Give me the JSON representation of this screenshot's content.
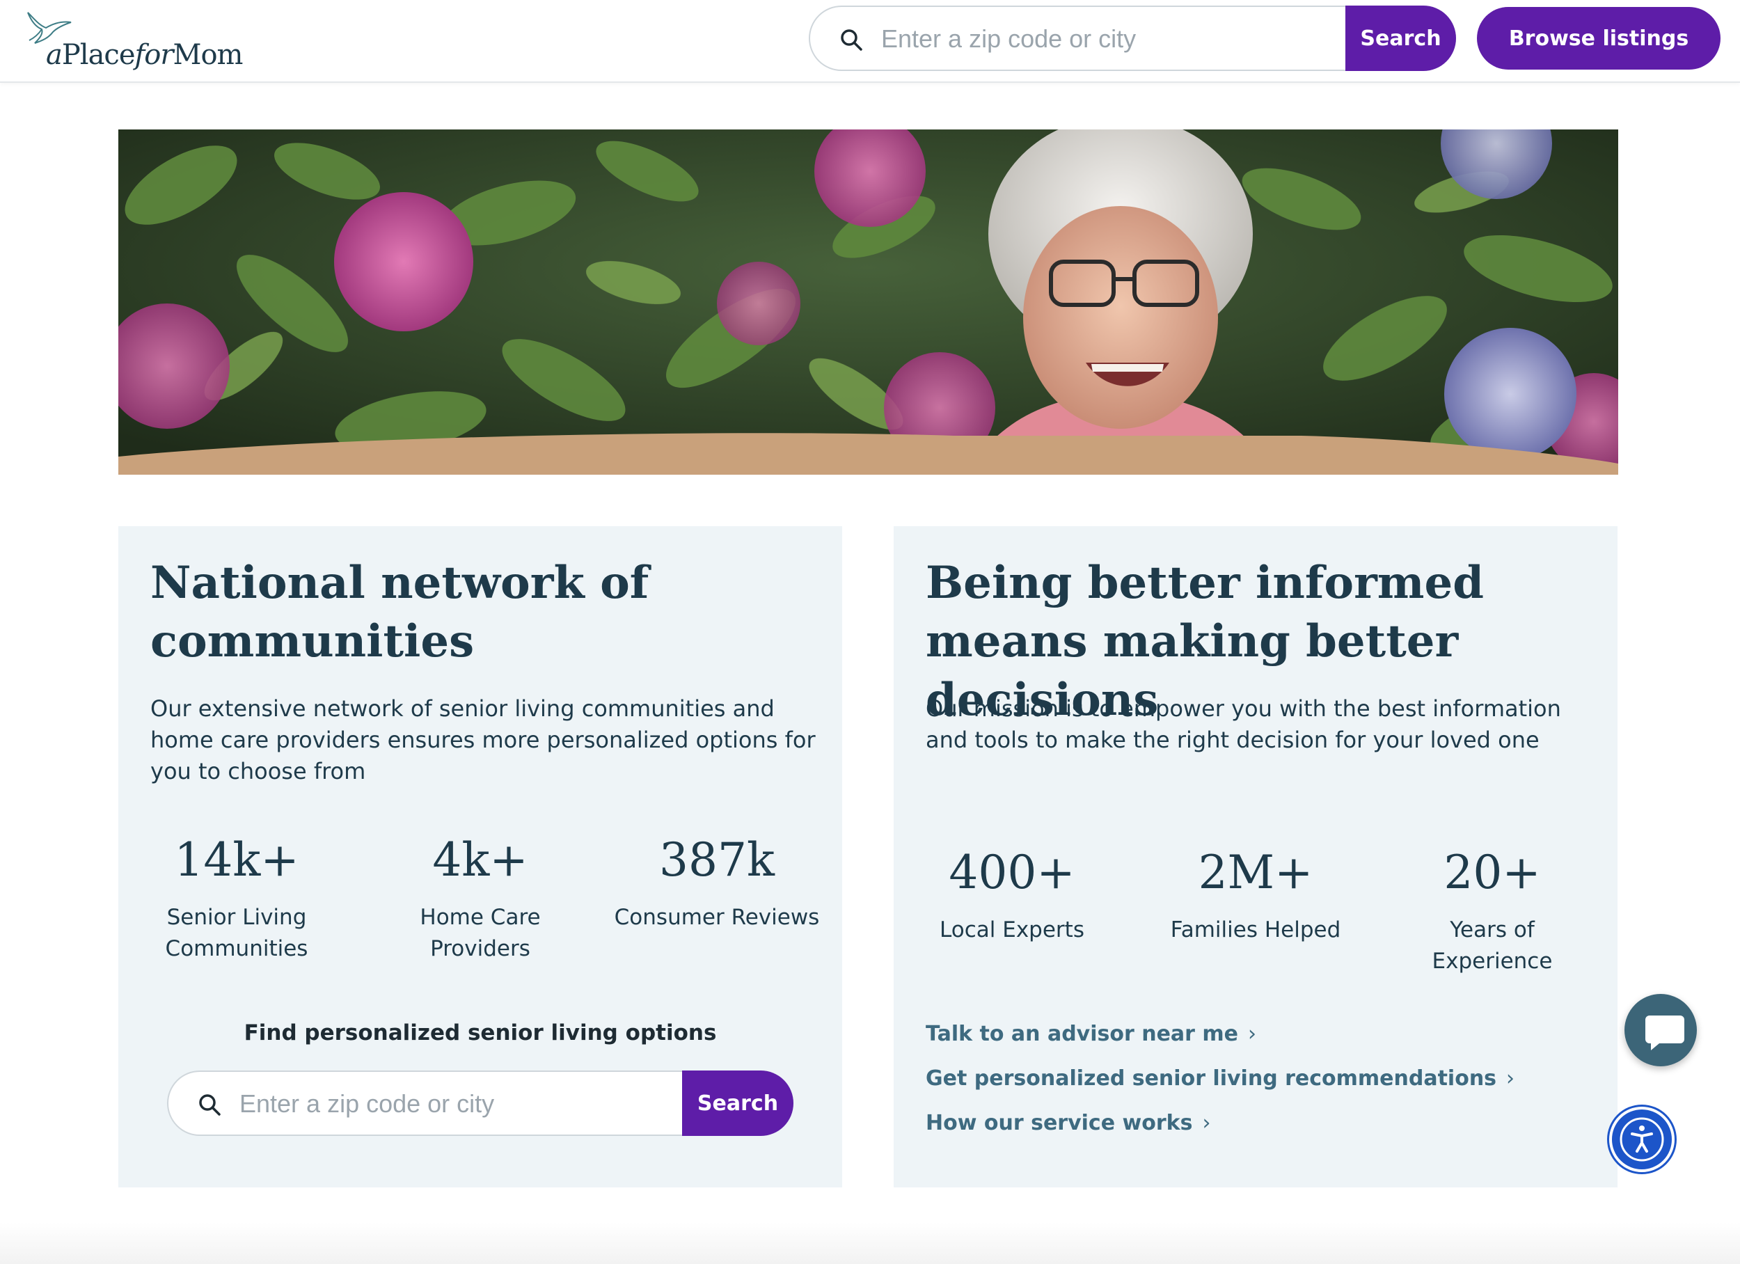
{
  "header": {
    "logo": {
      "text_a": "a",
      "text_place": "Place",
      "text_for": "for",
      "text_mom": "Mom"
    },
    "search": {
      "placeholder": "Enter a zip code or city",
      "value": "",
      "button_label": "Search"
    },
    "browse_label": "Browse listings"
  },
  "hero": {
    "image_name": "smiling-senior-woman-with-hydrangeas"
  },
  "network_card": {
    "title": "National network of communities",
    "description": "Our extensive network of senior living communities and home care providers ensures more personalized options for you to choose from",
    "stats": [
      {
        "value": "14k+",
        "label": "Senior Living Communities"
      },
      {
        "value": "4k+",
        "label": "Home Care Providers"
      },
      {
        "value": "387k",
        "label": "Consumer Reviews"
      }
    ],
    "find_title": "Find personalized senior living options",
    "search": {
      "placeholder": "Enter a zip code or city",
      "value": "",
      "button_label": "Search"
    }
  },
  "informed_card": {
    "title": "Being better informed means making better decisions",
    "description": "Our mission is to empower you with the best information and tools to make the right decision for your loved one",
    "stats": [
      {
        "value": "400+",
        "label": "Local Experts"
      },
      {
        "value": "2M+",
        "label": "Families Helped"
      },
      {
        "value": "20+",
        "label": "Years of Experience"
      }
    ],
    "links": [
      {
        "label": "Talk to an advisor near me"
      },
      {
        "label": "Get personalized senior living recommendations"
      },
      {
        "label": "How our service works"
      }
    ]
  },
  "colors": {
    "brand_purple": "#5e1da8",
    "heading_navy": "#1e3a4a",
    "card_bg": "#eef4f7",
    "link_teal": "#3e6a80",
    "chat_bg": "#3c6578",
    "accessibility_blue": "#1c55c9"
  },
  "icons": [
    "bird-logo-icon",
    "search-icon",
    "chevron-right-icon",
    "chat-bubble-icon",
    "accessibility-icon"
  ]
}
